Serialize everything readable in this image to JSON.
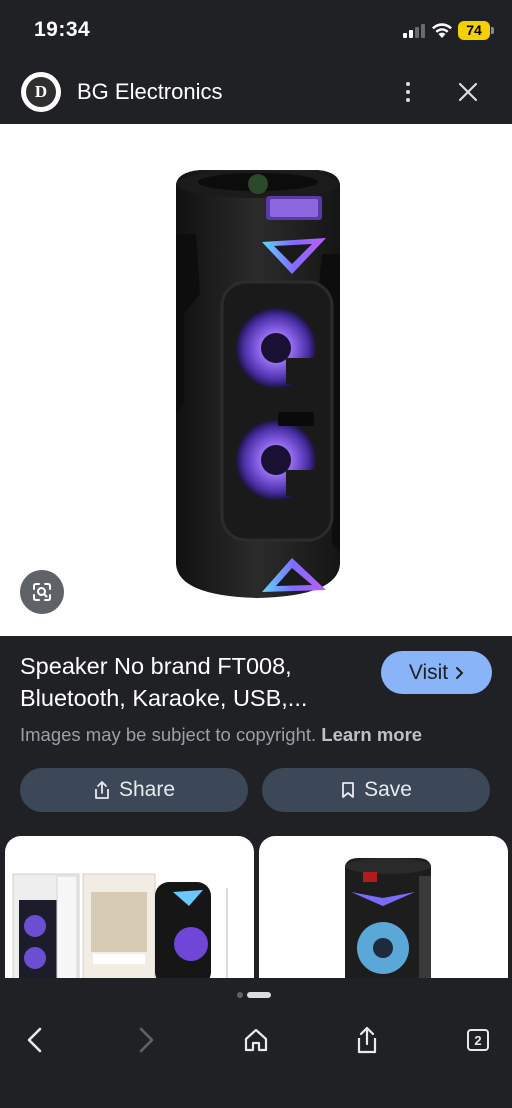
{
  "status_bar": {
    "time": "19:34",
    "battery": "74"
  },
  "header": {
    "logo_letter": "D",
    "site_name": "BG Electronics"
  },
  "product": {
    "title": "Speaker No brand FT008, Bluetooth, Karaoke, USB,...",
    "visit_label": "Visit",
    "copyright_text": "Images may be subject to copyright.",
    "learn_more": "Learn more"
  },
  "actions": {
    "share_label": "Share",
    "save_label": "Save"
  },
  "bottom_nav": {
    "tab_count": "2"
  },
  "icons": [
    "share-icon",
    "bookmark-icon",
    "lens-icon",
    "more-vert-icon",
    "close-icon",
    "back-icon",
    "forward-icon",
    "home-icon",
    "tabs-icon"
  ],
  "colors": {
    "background": "#202124",
    "visit": "#8ab4f8",
    "action_button": "#3c4758",
    "battery": "#f5d000"
  }
}
